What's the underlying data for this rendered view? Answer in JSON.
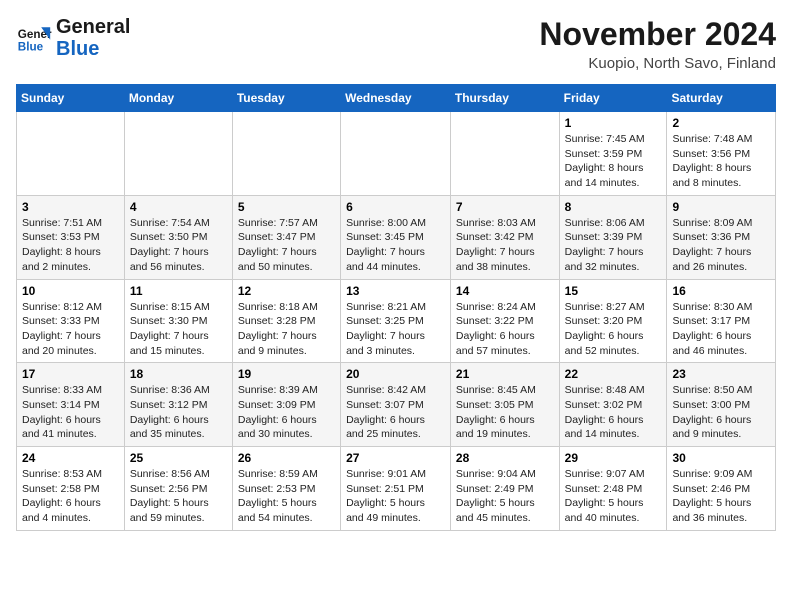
{
  "header": {
    "logo_line1": "General",
    "logo_line2": "Blue",
    "title": "November 2024",
    "subtitle": "Kuopio, North Savo, Finland"
  },
  "weekdays": [
    "Sunday",
    "Monday",
    "Tuesday",
    "Wednesday",
    "Thursday",
    "Friday",
    "Saturday"
  ],
  "weeks": [
    [
      {
        "day": "",
        "info": ""
      },
      {
        "day": "",
        "info": ""
      },
      {
        "day": "",
        "info": ""
      },
      {
        "day": "",
        "info": ""
      },
      {
        "day": "",
        "info": ""
      },
      {
        "day": "1",
        "info": "Sunrise: 7:45 AM\nSunset: 3:59 PM\nDaylight: 8 hours\nand 14 minutes."
      },
      {
        "day": "2",
        "info": "Sunrise: 7:48 AM\nSunset: 3:56 PM\nDaylight: 8 hours\nand 8 minutes."
      }
    ],
    [
      {
        "day": "3",
        "info": "Sunrise: 7:51 AM\nSunset: 3:53 PM\nDaylight: 8 hours\nand 2 minutes."
      },
      {
        "day": "4",
        "info": "Sunrise: 7:54 AM\nSunset: 3:50 PM\nDaylight: 7 hours\nand 56 minutes."
      },
      {
        "day": "5",
        "info": "Sunrise: 7:57 AM\nSunset: 3:47 PM\nDaylight: 7 hours\nand 50 minutes."
      },
      {
        "day": "6",
        "info": "Sunrise: 8:00 AM\nSunset: 3:45 PM\nDaylight: 7 hours\nand 44 minutes."
      },
      {
        "day": "7",
        "info": "Sunrise: 8:03 AM\nSunset: 3:42 PM\nDaylight: 7 hours\nand 38 minutes."
      },
      {
        "day": "8",
        "info": "Sunrise: 8:06 AM\nSunset: 3:39 PM\nDaylight: 7 hours\nand 32 minutes."
      },
      {
        "day": "9",
        "info": "Sunrise: 8:09 AM\nSunset: 3:36 PM\nDaylight: 7 hours\nand 26 minutes."
      }
    ],
    [
      {
        "day": "10",
        "info": "Sunrise: 8:12 AM\nSunset: 3:33 PM\nDaylight: 7 hours\nand 20 minutes."
      },
      {
        "day": "11",
        "info": "Sunrise: 8:15 AM\nSunset: 3:30 PM\nDaylight: 7 hours\nand 15 minutes."
      },
      {
        "day": "12",
        "info": "Sunrise: 8:18 AM\nSunset: 3:28 PM\nDaylight: 7 hours\nand 9 minutes."
      },
      {
        "day": "13",
        "info": "Sunrise: 8:21 AM\nSunset: 3:25 PM\nDaylight: 7 hours\nand 3 minutes."
      },
      {
        "day": "14",
        "info": "Sunrise: 8:24 AM\nSunset: 3:22 PM\nDaylight: 6 hours\nand 57 minutes."
      },
      {
        "day": "15",
        "info": "Sunrise: 8:27 AM\nSunset: 3:20 PM\nDaylight: 6 hours\nand 52 minutes."
      },
      {
        "day": "16",
        "info": "Sunrise: 8:30 AM\nSunset: 3:17 PM\nDaylight: 6 hours\nand 46 minutes."
      }
    ],
    [
      {
        "day": "17",
        "info": "Sunrise: 8:33 AM\nSunset: 3:14 PM\nDaylight: 6 hours\nand 41 minutes."
      },
      {
        "day": "18",
        "info": "Sunrise: 8:36 AM\nSunset: 3:12 PM\nDaylight: 6 hours\nand 35 minutes."
      },
      {
        "day": "19",
        "info": "Sunrise: 8:39 AM\nSunset: 3:09 PM\nDaylight: 6 hours\nand 30 minutes."
      },
      {
        "day": "20",
        "info": "Sunrise: 8:42 AM\nSunset: 3:07 PM\nDaylight: 6 hours\nand 25 minutes."
      },
      {
        "day": "21",
        "info": "Sunrise: 8:45 AM\nSunset: 3:05 PM\nDaylight: 6 hours\nand 19 minutes."
      },
      {
        "day": "22",
        "info": "Sunrise: 8:48 AM\nSunset: 3:02 PM\nDaylight: 6 hours\nand 14 minutes."
      },
      {
        "day": "23",
        "info": "Sunrise: 8:50 AM\nSunset: 3:00 PM\nDaylight: 6 hours\nand 9 minutes."
      }
    ],
    [
      {
        "day": "24",
        "info": "Sunrise: 8:53 AM\nSunset: 2:58 PM\nDaylight: 6 hours\nand 4 minutes."
      },
      {
        "day": "25",
        "info": "Sunrise: 8:56 AM\nSunset: 2:56 PM\nDaylight: 5 hours\nand 59 minutes."
      },
      {
        "day": "26",
        "info": "Sunrise: 8:59 AM\nSunset: 2:53 PM\nDaylight: 5 hours\nand 54 minutes."
      },
      {
        "day": "27",
        "info": "Sunrise: 9:01 AM\nSunset: 2:51 PM\nDaylight: 5 hours\nand 49 minutes."
      },
      {
        "day": "28",
        "info": "Sunrise: 9:04 AM\nSunset: 2:49 PM\nDaylight: 5 hours\nand 45 minutes."
      },
      {
        "day": "29",
        "info": "Sunrise: 9:07 AM\nSunset: 2:48 PM\nDaylight: 5 hours\nand 40 minutes."
      },
      {
        "day": "30",
        "info": "Sunrise: 9:09 AM\nSunset: 2:46 PM\nDaylight: 5 hours\nand 36 minutes."
      }
    ]
  ]
}
